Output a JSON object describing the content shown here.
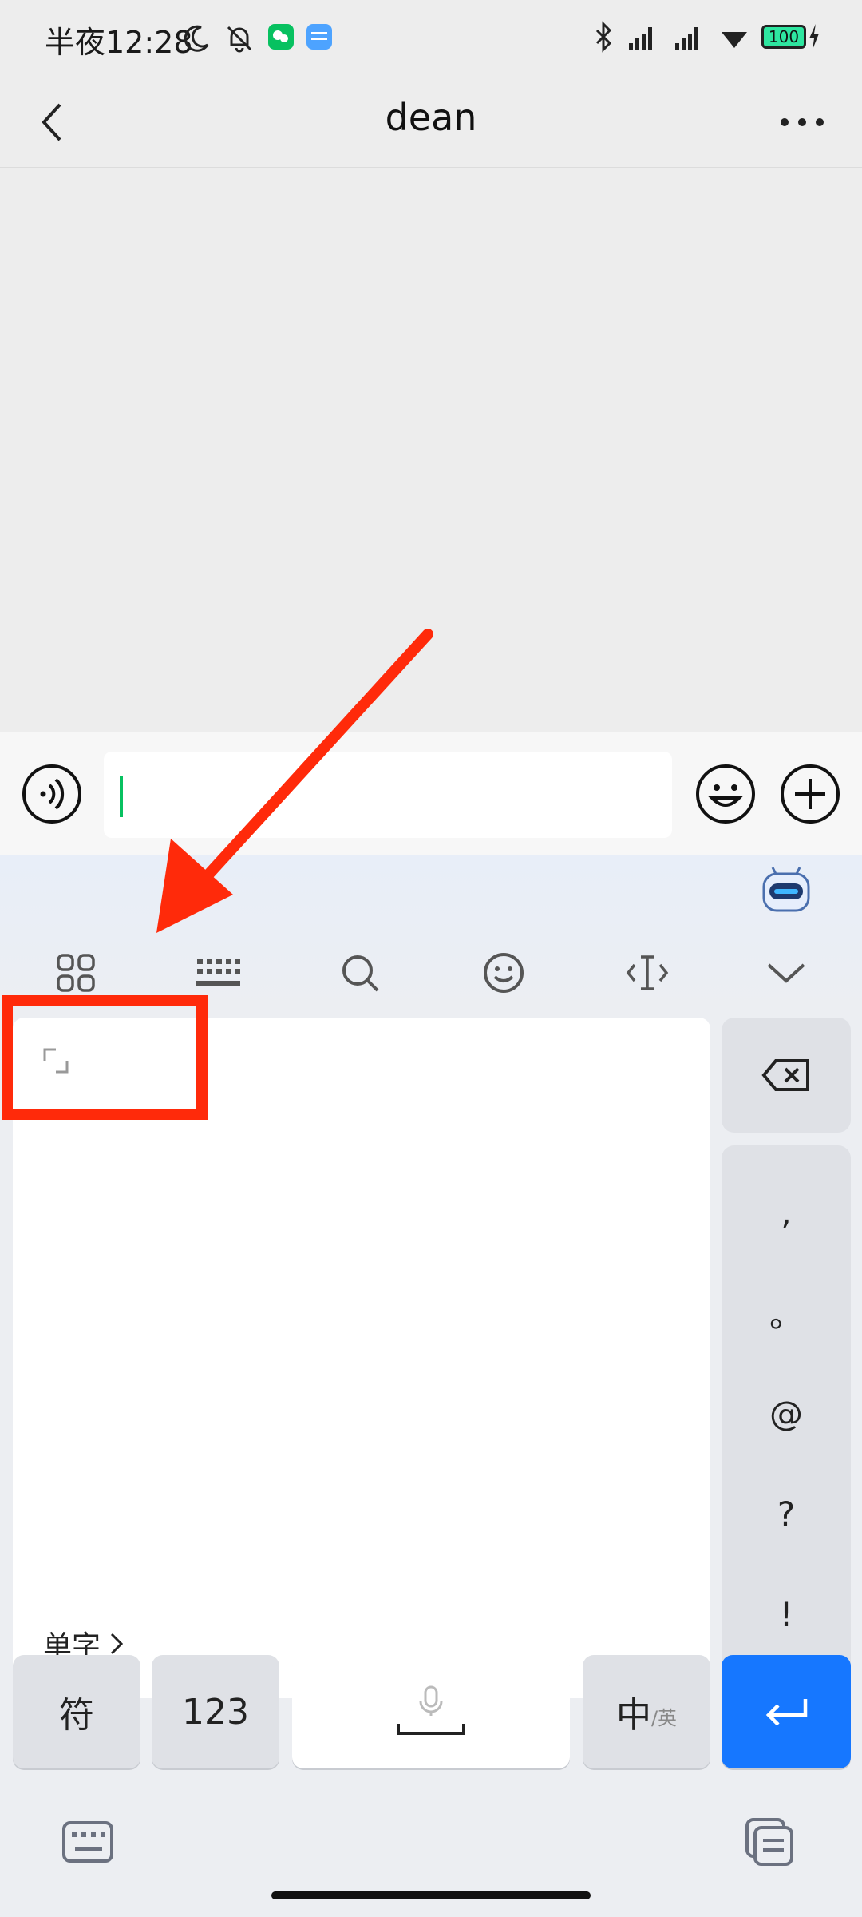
{
  "status_bar": {
    "time": "半夜12:28",
    "battery": "100"
  },
  "header": {
    "title": "dean"
  },
  "keyboard": {
    "candidate_link": "单字",
    "punctuation": [
      ",",
      "。",
      "@",
      "?",
      "!"
    ],
    "keys": {
      "symbols": "符",
      "numbers": "123",
      "lang_main": "中",
      "lang_sub": "/英"
    }
  },
  "colors": {
    "annotation": "#ff2a0a",
    "enter_key": "#1677ff",
    "caret": "#07c160"
  }
}
